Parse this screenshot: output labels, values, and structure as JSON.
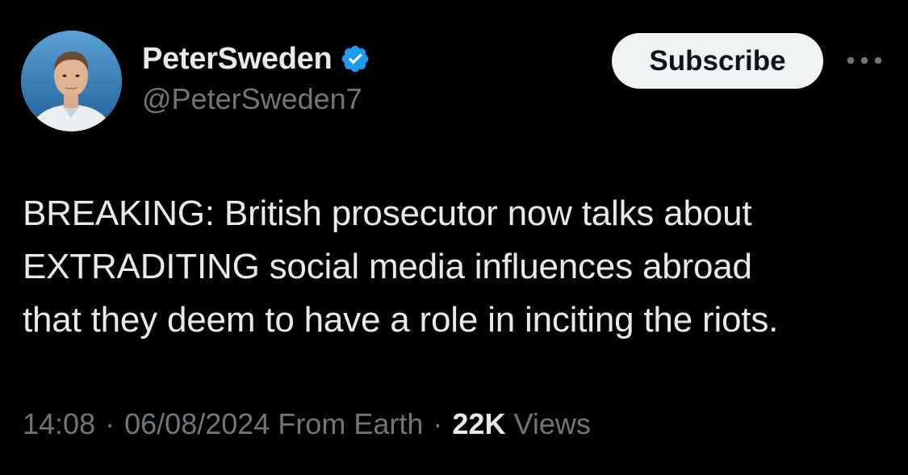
{
  "author": {
    "display_name": "PeterSweden",
    "handle": "@PeterSweden7",
    "verified_icon": "verified-badge-icon",
    "avatar": "profile-photo"
  },
  "actions": {
    "subscribe_label": "Subscribe",
    "more_icon": "more-options-icon"
  },
  "tweet": {
    "lines": [
      "BREAKING: British prosecutor now talks about",
      "EXTRADITING social media influences abroad",
      "that they deem to have a role in inciting the riots."
    ]
  },
  "meta": {
    "time": "14:08",
    "date": "06/08/2024",
    "source": "From Earth",
    "separator": "·",
    "views_count": "22K",
    "views_label": "Views"
  },
  "colors": {
    "background": "#000000",
    "text_primary": "#e7e9ea",
    "text_secondary": "#71767b",
    "verified": "#1d9bf0",
    "button_bg": "#eff3f4",
    "button_text": "#0f1419"
  }
}
